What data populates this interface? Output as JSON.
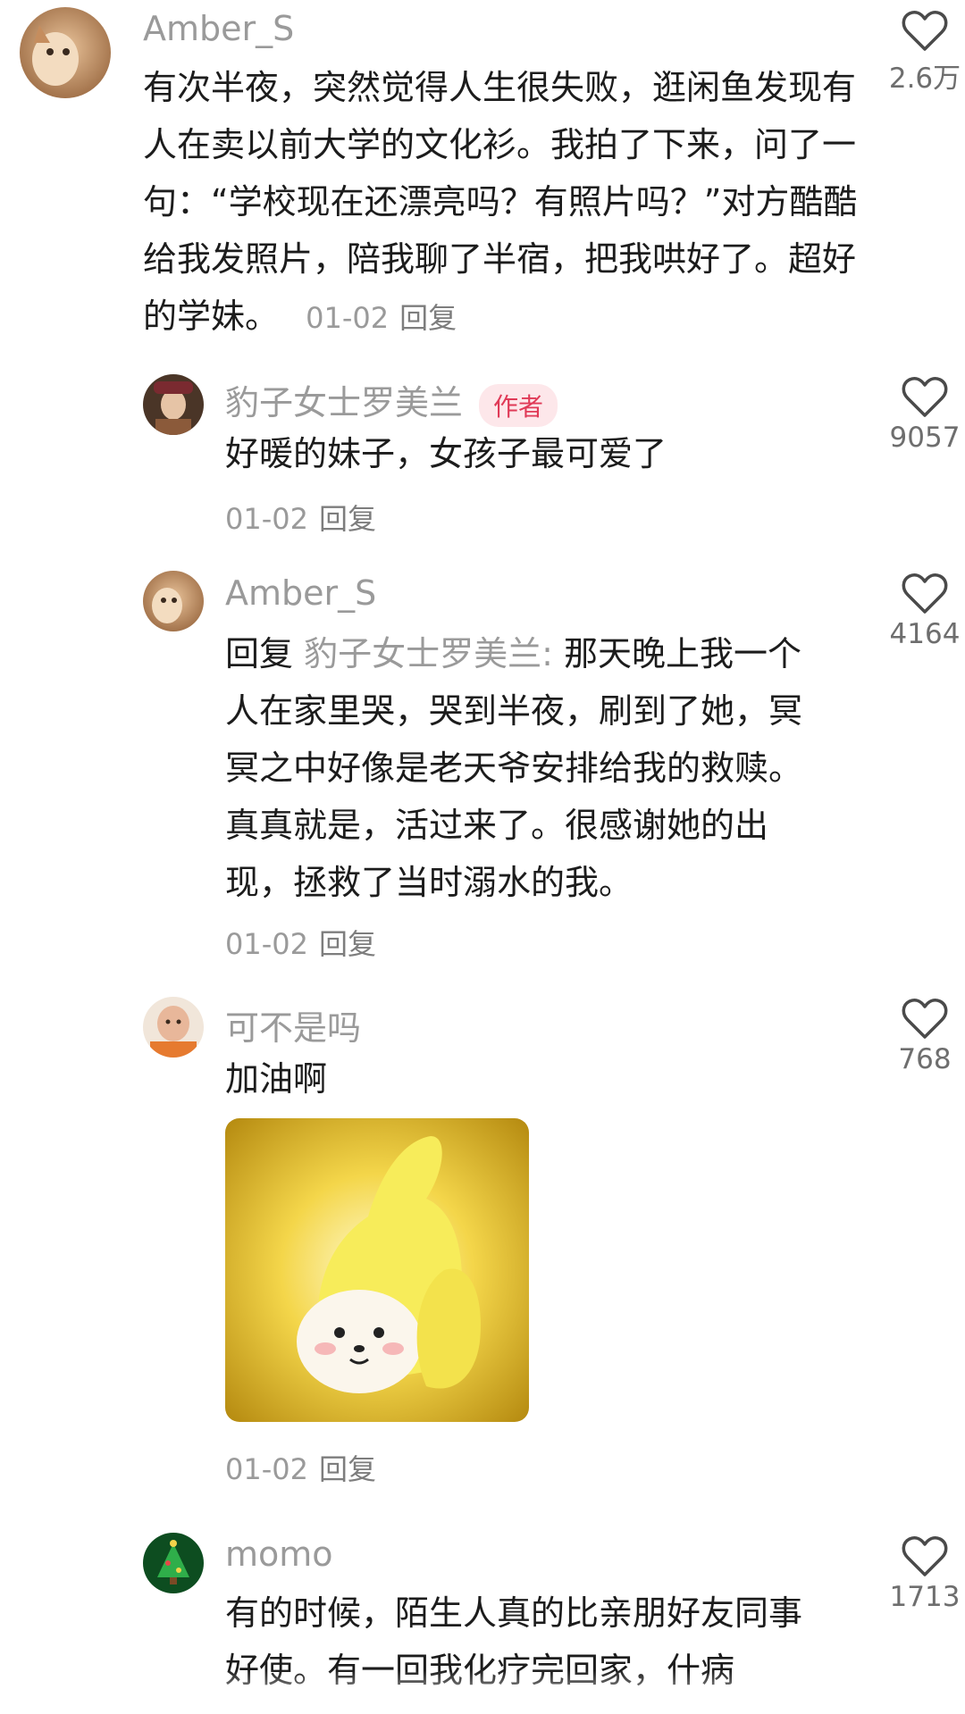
{
  "comments": [
    {
      "username": "Amber_S",
      "text": "有次半夜，突然觉得人生很失败，逛闲鱼发现有人在卖以前大学的文化衫。我拍了下来，问了一句：“学校现在还漂亮吗？有照片吗？”对方酷酷给我发照片，陪我聊了半宿，把我哄好了。超好的学妹。",
      "date": "01-02",
      "reply_label": "回复",
      "likes": "2.6万"
    },
    {
      "username": "豹子女士罗美兰",
      "badge": "作者",
      "text": "好暖的妹子，女孩子最可爱了",
      "date": "01-02",
      "reply_label": "回复",
      "likes": "9057"
    },
    {
      "username": "Amber_S",
      "reply_prefix": "回复",
      "mention": "豹子女士罗美兰:",
      "text": "那天晚上我一个人在家里哭，哭到半夜，刷到了她，冥冥之中好像是老天爷安排给我的救赎。真真就是，活过来了。很感谢她的出现，拯救了当时溺水的我。",
      "date": "01-02",
      "reply_label": "回复",
      "likes": "4164"
    },
    {
      "username": "可不是吗",
      "text": "加油啊",
      "date": "01-02",
      "reply_label": "回复",
      "likes": "768",
      "sticker": "banana-cat-thumbs-up"
    },
    {
      "username": "momo",
      "text": "有的时候，陌生人真的比亲朋好友同事好使。有一回我化疗完回家，什病",
      "likes": "1713"
    }
  ],
  "icons": {
    "like": "heart-outline-icon"
  },
  "colors": {
    "username": "#9a9a9a",
    "badge_bg": "#fde7ea",
    "badge_text": "#e03a57",
    "body_text": "#1c1c1c"
  }
}
